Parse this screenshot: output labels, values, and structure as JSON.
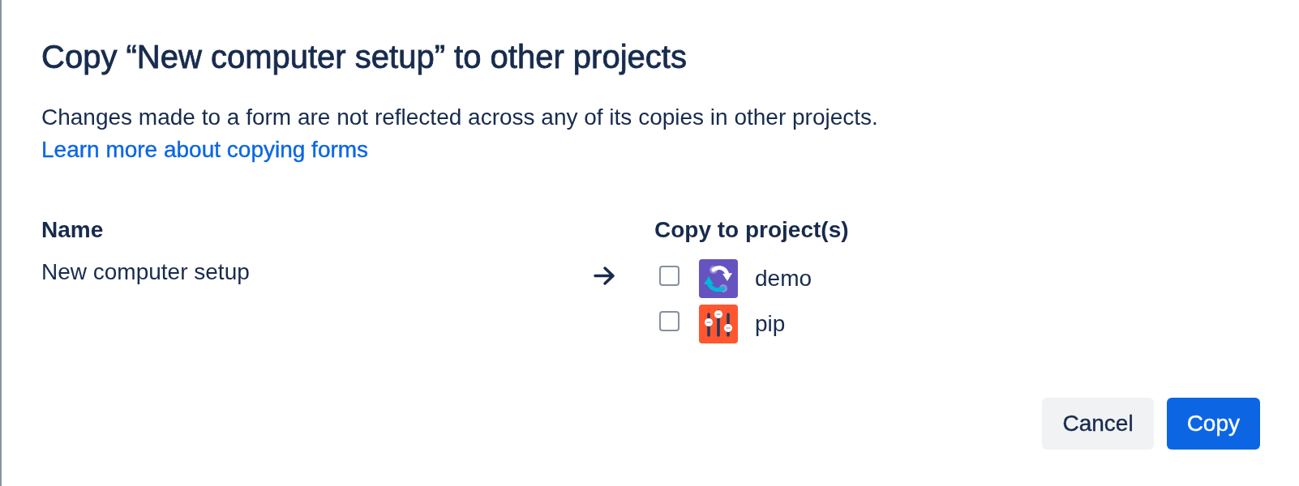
{
  "dialog": {
    "title": "Copy “New computer setup” to other projects",
    "description": "Changes made to a form are not reflected across any of its copies in other projects.",
    "link": "Learn more about copying forms"
  },
  "table": {
    "columns": [
      "Name",
      "Copy to project(s)"
    ],
    "form_name": "New computer setup",
    "projects": [
      {
        "name": "demo",
        "kind": "sync",
        "checked": false
      },
      {
        "name": "pip",
        "kind": "sliders",
        "checked": false
      }
    ]
  },
  "buttons": [
    {
      "label": "Cancel",
      "kind": "secondary"
    },
    {
      "label": "Copy",
      "kind": "primary"
    }
  ]
}
